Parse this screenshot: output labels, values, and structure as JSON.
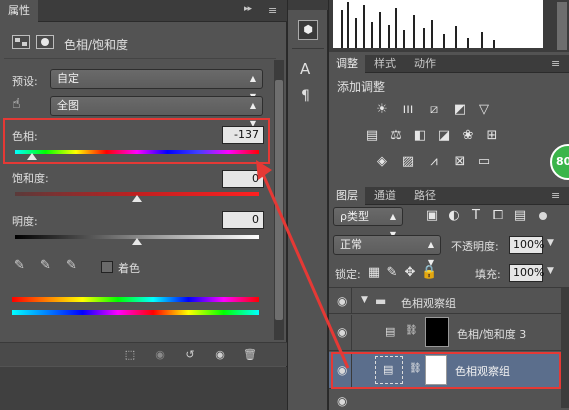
{
  "properties_panel": {
    "tab_title": "属性",
    "adjustment_name": "色相/饱和度",
    "preset_label": "预设:",
    "preset_value": "自定",
    "channel_value": "全图",
    "hue_label": "色相:",
    "hue_value": "-137",
    "saturation_label": "饱和度:",
    "saturation_value": "0",
    "lightness_label": "明度:",
    "lightness_value": "0",
    "colorize_label": "着色"
  },
  "adjustments_panel": {
    "tabs": [
      "调整",
      "样式",
      "动作"
    ],
    "heading": "添加调整"
  },
  "layers_panel": {
    "tabs": [
      "图层",
      "通道",
      "路径"
    ],
    "filter_kind": "ρ类型",
    "blend_mode": "正常",
    "opacity_label": "不透明度:",
    "opacity_value": "100%",
    "lock_label": "锁定:",
    "fill_label": "填充:",
    "fill_value": "100%",
    "layers": [
      {
        "name": "色相观察组"
      },
      {
        "name": "色相/饱和度 3"
      },
      {
        "name": "色相观察组"
      }
    ]
  },
  "badge": {
    "text": "80"
  },
  "colors": {
    "accent_red": "#e53935",
    "panel": "#535353",
    "selected_row": "#5b6e8c"
  },
  "hue_slider_position_ratio": 0.07,
  "saturation_slider_position_ratio": 0.5,
  "lightness_slider_position_ratio": 0.5
}
